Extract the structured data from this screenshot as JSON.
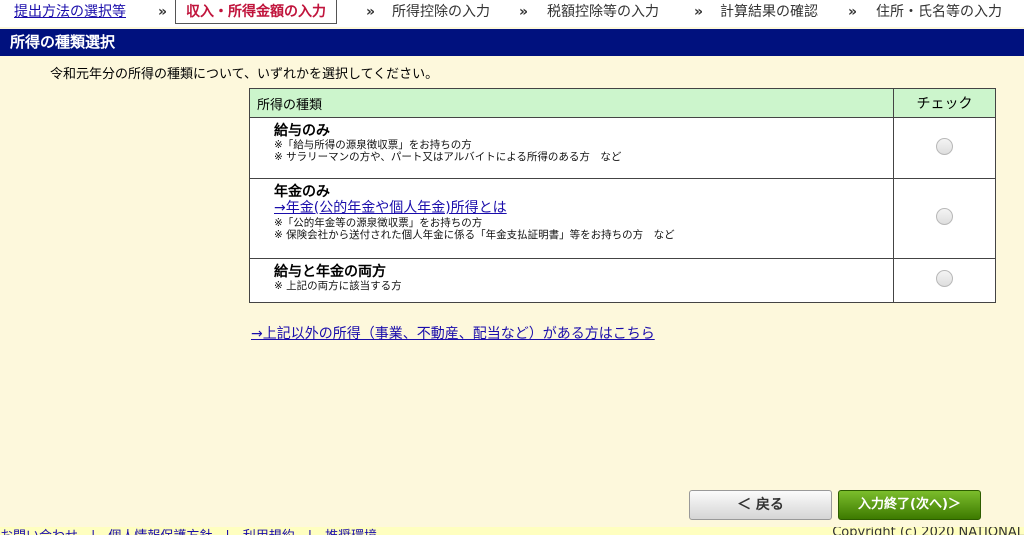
{
  "breadcrumb": {
    "step1": "提出方法の選択等",
    "current": "収入・所得金額の入力",
    "step3": "所得控除の入力",
    "step4": "税額控除等の入力",
    "step5": "計算結果の確認",
    "step6": "住所・氏名等の入力",
    "separator": "»"
  },
  "section_title": "所得の種類選択",
  "instruction": "令和元年分の所得の種類について、いずれかを選択してください。",
  "table": {
    "header_type": "所得の種類",
    "header_check": "チェック",
    "options": [
      {
        "title": "給与のみ",
        "note1": "※「給与所得の源泉徴収票」をお持ちの方",
        "note2": "※ サラリーマンの方や、パート又はアルバイトによる所得のある方　など"
      },
      {
        "title": "年金のみ",
        "link": "→年金(公的年金や個人年金)所得とは",
        "note1": "※「公的年金等の源泉徴収票」をお持ちの方",
        "note2": "※ 保険会社から送付された個人年金に係る「年金支払証明書」等をお持ちの方　など"
      },
      {
        "title": "給与と年金の両方",
        "note1": "※ 上記の両方に該当する方"
      }
    ]
  },
  "other_income_link": "→上記以外の所得（事業、不動産、配当など）がある方はこちら",
  "buttons": {
    "back": "＜ 戻る",
    "next": "入力終了(次へ)＞"
  },
  "footer": {
    "links": "お問い合わせ　|　個人情報保護方針　|　利用規約　|　推奨環境",
    "copyright": "Copyright (c) 2020 NATIONAL"
  }
}
